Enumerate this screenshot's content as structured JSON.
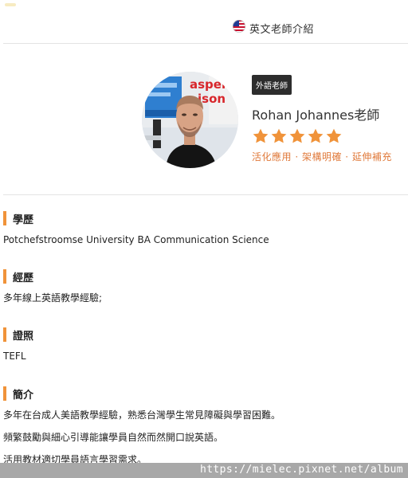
{
  "header": {
    "tab_label": "英文老師介紹",
    "tab_icon": "us-flag-icon"
  },
  "teacher": {
    "badge": "外語老師",
    "name": "Rohan Johannes老師",
    "rating": 5,
    "rating_max": 5,
    "star_color": "#f0933a",
    "tags": "活化應用 · 架構明確 · 延伸補充",
    "photo_sign_text": "Jasper Edison"
  },
  "sections": [
    {
      "title": "學歷",
      "lines": [
        "Potchefstroomse University BA Communication Science"
      ]
    },
    {
      "title": "經歷",
      "lines": [
        "多年線上英語教學經驗;"
      ]
    },
    {
      "title": "證照",
      "lines": [
        "TEFL"
      ]
    },
    {
      "title": "簡介",
      "lines": [
        "多年在台成人美語教學經驗，熟悉台灣學生常見障礙與學習困難。",
        "頻繁鼓勵與細心引導能讓學員自然而然開口說英語。",
        "活用教材適切學員語言學習需求。"
      ]
    }
  ],
  "watermark": {
    "url": "https://mielec.pixnet.net/album"
  },
  "colors": {
    "accent": "#f0933a",
    "badge_bg": "#2d2d2d",
    "tag_text": "#e07a3b"
  }
}
